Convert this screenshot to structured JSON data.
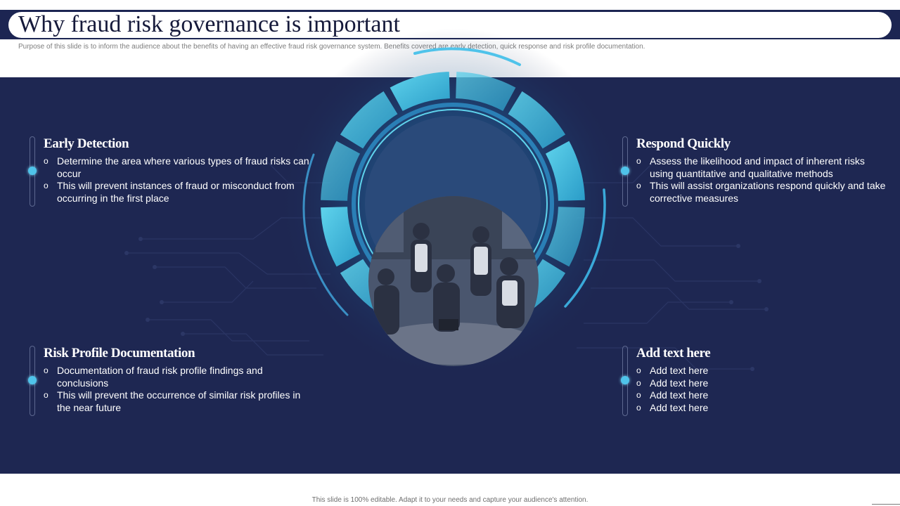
{
  "slide": {
    "title": "Why fraud risk governance is important",
    "subtitle": "Purpose of this slide is to inform the audience about the benefits of having an effective fraud risk governance system. Benefits covered are early detection, quick response and risk profile documentation.",
    "footer": "This slide is 100% editable. Adapt it to your needs and capture your audience's attention."
  },
  "blocks": {
    "early_detection": {
      "title": "Early Detection",
      "items": [
        "Determine the area where various types of fraud risks can occur",
        "This will prevent instances of fraud or misconduct from occurring in the first place"
      ]
    },
    "respond_quickly": {
      "title": "Respond Quickly",
      "items": [
        "Assess the likelihood and impact of inherent risks using quantitative and qualitative methods",
        "This will assist organizations respond quickly and take corrective measures"
      ]
    },
    "risk_profile": {
      "title": "Risk Profile Documentation",
      "items": [
        "Documentation of fraud risk profile findings and conclusions",
        "This will prevent the occurrence of similar risk profiles in the near future"
      ]
    },
    "add_text": {
      "title": "Add text here",
      "items": [
        "Add text here",
        "Add text here",
        "Add text here",
        "Add text here"
      ]
    }
  },
  "colors": {
    "panel_bg": "#1e2752",
    "accent": "#4fc3ea",
    "header": "#1c2552"
  }
}
